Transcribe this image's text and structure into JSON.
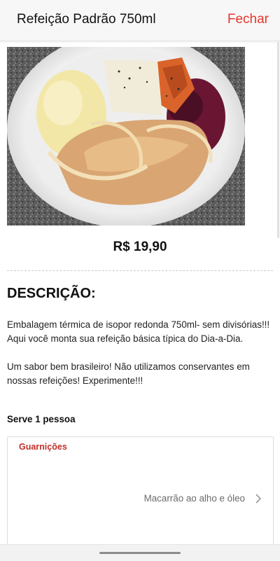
{
  "header": {
    "title": "Refeição Padrão 750ml",
    "close_label": "Fechar"
  },
  "product": {
    "image_icon": "food-photo",
    "price": "R$ 19,90",
    "section_title": "DESCRIÇÃO:",
    "description": [
      "Embalagem térmica de isopor redonda 750ml- sem divisórias!!! Aqui você monta sua refeição básica típica do Dia-a-Dia.",
      "Um sabor bem brasileiro! Não utilizamos conservantes em nossas refeições! Experimente!!!"
    ],
    "serves": "Serve 1 pessoa"
  },
  "options": {
    "group_label": "Guarnições",
    "selected_value": "Macarrão ao alho e óleo",
    "chevron_icon": "chevron-right-icon"
  },
  "colors": {
    "accent": "#e5362b",
    "group_label": "#c0302a",
    "header_bg": "#f7f7f7"
  }
}
